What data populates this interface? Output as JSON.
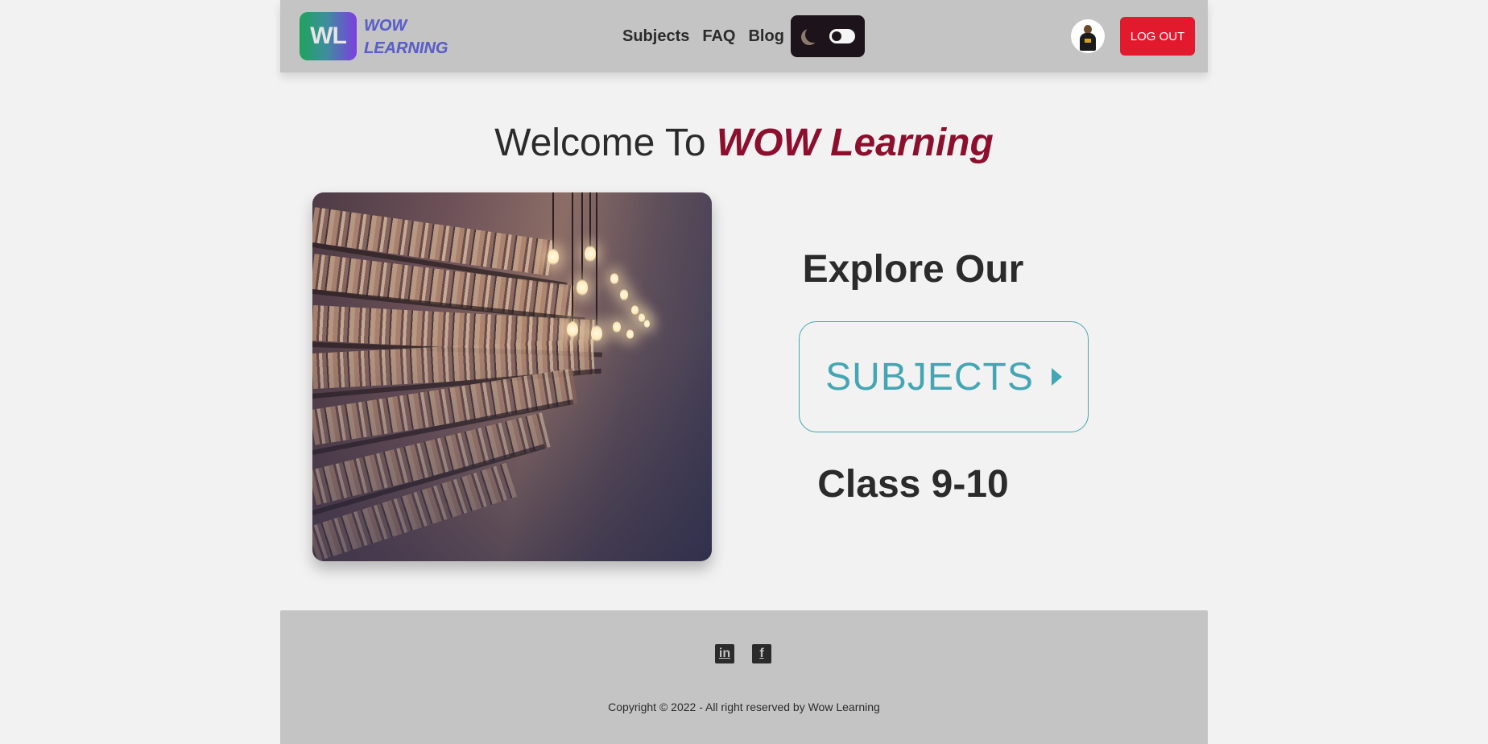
{
  "header": {
    "logo_mark": "WL",
    "logo_line1": "WOW",
    "logo_line2": "LEARNING",
    "nav": [
      {
        "label": "Subjects"
      },
      {
        "label": "FAQ"
      },
      {
        "label": "Blog"
      }
    ],
    "theme_toggle_icon": "moon-icon",
    "logout_label": "LOG OUT"
  },
  "main": {
    "welcome_prefix": "Welcome To ",
    "welcome_brand": "WOW Learning",
    "explore_title": "Explore Our",
    "subjects_button_label": "SUBJECTS",
    "class_title": "Class 9-10"
  },
  "footer": {
    "social": [
      {
        "icon": "linkedin-icon",
        "glyph": "in"
      },
      {
        "icon": "facebook-icon",
        "glyph": "f"
      }
    ],
    "copyright": "Copyright © 2022 - All right reserved by Wow Learning"
  },
  "colors": {
    "navbar_bg": "#c4c4c4",
    "page_bg": "#f2f2f2",
    "brand": "#8c0f2e",
    "accent": "#44a6b4",
    "logout": "#e3192e",
    "toggle_bg": "#1c141a"
  }
}
